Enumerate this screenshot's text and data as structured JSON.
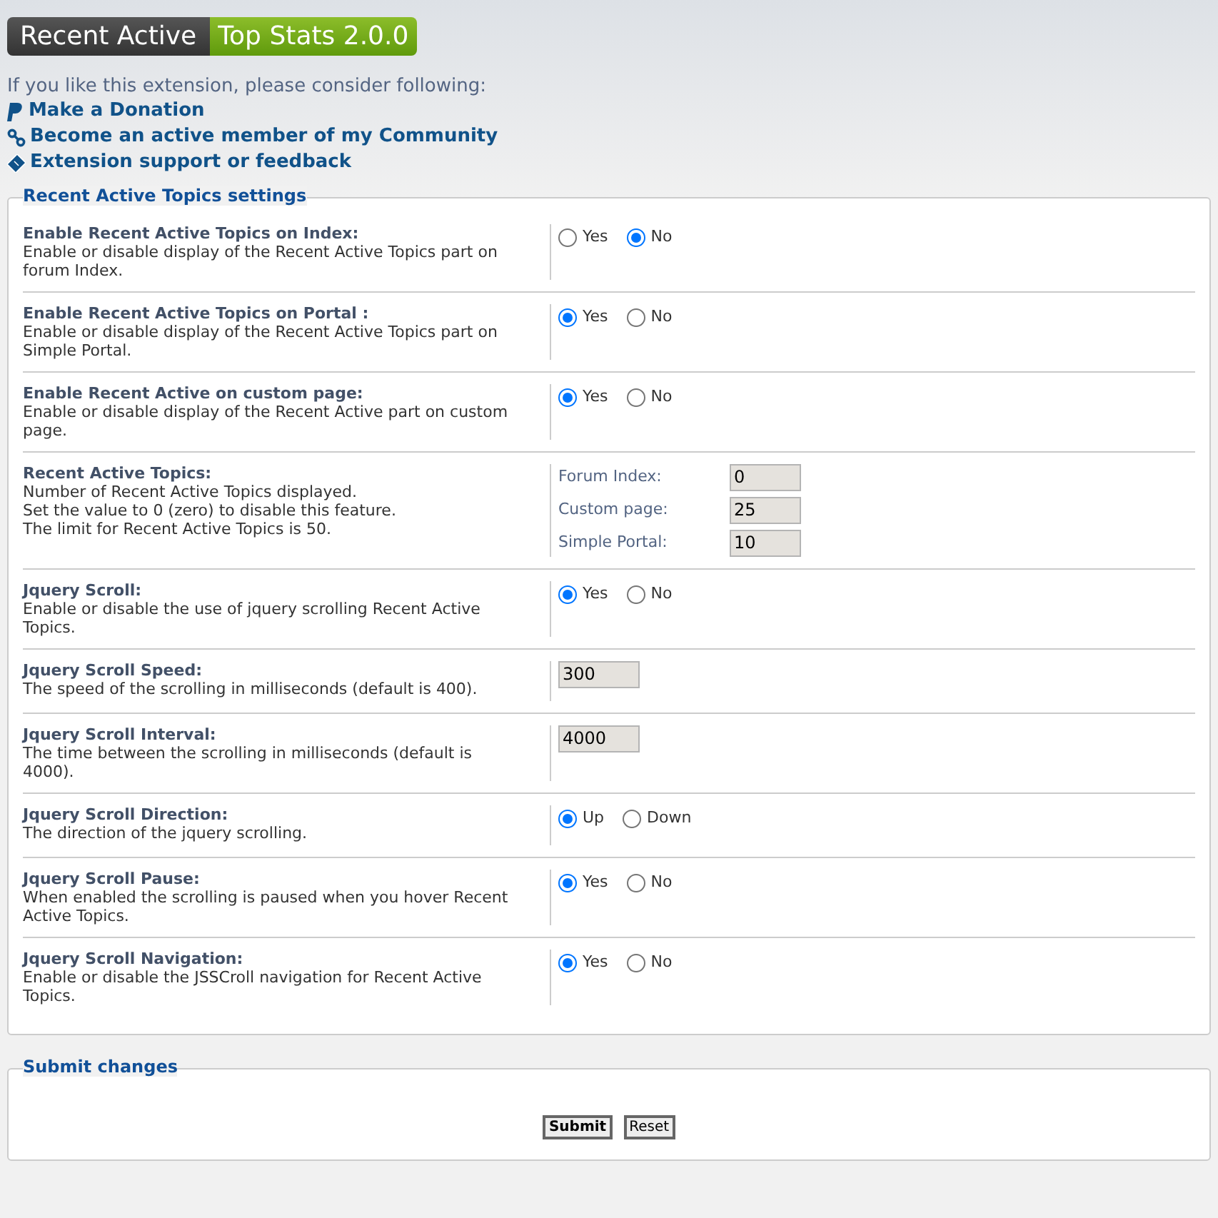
{
  "header": {
    "part_1": "Recent Active",
    "part_2": "Top Stats 2.0.0"
  },
  "intro": "If you like this extension, please consider following:",
  "links": [
    {
      "kind": "paypal",
      "label": "Make a Donation"
    },
    {
      "kind": "chain",
      "label": "Become an active member of my Community"
    },
    {
      "kind": "tag",
      "label": "Extension support or feedback"
    }
  ],
  "settings": {
    "legend": "Recent Active Topics settings",
    "rows": [
      {
        "title": "Enable Recent Active Topics on Index:",
        "description": [
          "Enable or disable display of the Recent Active Topics part on forum Index."
        ],
        "kind": "radio",
        "options": [
          {
            "label": "Yes",
            "selected": false
          },
          {
            "label": "No",
            "selected": true
          }
        ]
      },
      {
        "title": "Enable Recent Active Topics on Portal :",
        "description": [
          "Enable or disable display of the Recent Active Topics part on Simple Portal."
        ],
        "kind": "radio",
        "options": [
          {
            "label": "Yes",
            "selected": true
          },
          {
            "label": "No",
            "selected": false
          }
        ]
      },
      {
        "title": "Enable Recent Active on custom page:",
        "description": [
          "Enable or disable display of the Recent Active part on custom page."
        ],
        "kind": "radio",
        "options": [
          {
            "label": "Yes",
            "selected": true
          },
          {
            "label": "No",
            "selected": false
          }
        ]
      },
      {
        "title": "Recent Active Topics:",
        "description": [
          "Number of Recent Active Topics displayed.",
          "Set the value to 0 (zero) to disable this feature.",
          "The limit for Recent Active Topics is 50."
        ],
        "kind": "fields",
        "fields": [
          {
            "label": "Forum Index:",
            "value": "0"
          },
          {
            "label": "Custom page:",
            "value": "25"
          },
          {
            "label": "Simple Portal:",
            "value": "10"
          }
        ]
      },
      {
        "title": "Jquery Scroll:",
        "description": [
          "Enable or disable the use of jquery scrolling Recent Active Topics."
        ],
        "kind": "radio",
        "options": [
          {
            "label": "Yes",
            "selected": true
          },
          {
            "label": "No",
            "selected": false
          }
        ]
      },
      {
        "title": "Jquery Scroll Speed:",
        "description": [
          "The speed of the scrolling in milliseconds (default is 400)."
        ],
        "kind": "input",
        "value": "300"
      },
      {
        "title": "Jquery Scroll Interval:",
        "description": [
          "The time between the scrolling in milliseconds (default is 4000)."
        ],
        "kind": "input",
        "value": "4000"
      },
      {
        "title": "Jquery Scroll Direction:",
        "description": [
          "The direction of the jquery scrolling."
        ],
        "kind": "radio",
        "options": [
          {
            "label": "Up",
            "selected": true
          },
          {
            "label": "Down",
            "selected": false
          }
        ]
      },
      {
        "title": "Jquery Scroll Pause:",
        "description": [
          "When enabled the scrolling is paused when you hover Recent Active Topics."
        ],
        "kind": "radio",
        "options": [
          {
            "label": "Yes",
            "selected": true
          },
          {
            "label": "No",
            "selected": false
          }
        ]
      },
      {
        "title": "Jquery Scroll Navigation:",
        "description": [
          "Enable or disable the JSSCroll navigation for Recent Active Topics."
        ],
        "kind": "radio",
        "options": [
          {
            "label": "Yes",
            "selected": true
          },
          {
            "label": "No",
            "selected": false
          }
        ]
      }
    ]
  },
  "submit": {
    "legend": "Submit changes",
    "buttons": [
      "Submit",
      "Reset"
    ]
  }
}
